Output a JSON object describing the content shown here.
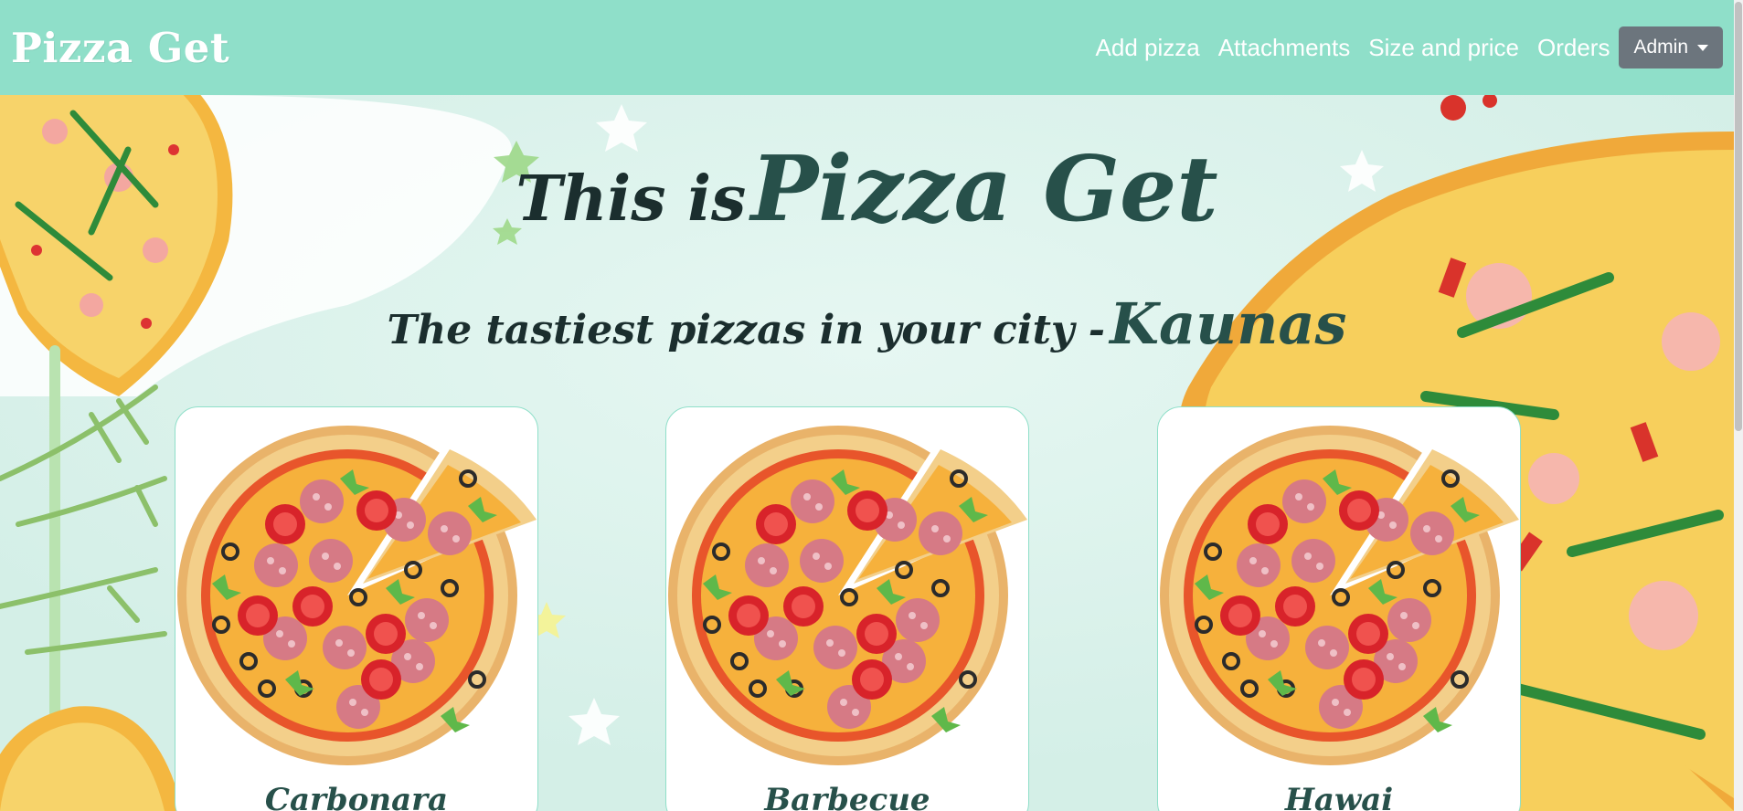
{
  "navbar": {
    "brand": "Pizza Get",
    "links": [
      "Add pizza",
      "Attachments",
      "Size and price",
      "Orders"
    ],
    "admin_label": "Admin"
  },
  "hero": {
    "title_pre": "This is",
    "title_brand": "Pizza Get",
    "subtitle_pre": "The tastiest pizzas in your city -",
    "subtitle_city": "Kaunas"
  },
  "pizzas": [
    {
      "name": "Carbonara"
    },
    {
      "name": "Barbecue"
    },
    {
      "name": "Hawai"
    }
  ],
  "colors": {
    "navbar": "#8fdfc9",
    "background": "#e2f4ef",
    "heading": "#27504a",
    "admin_button": "#6c757d"
  }
}
